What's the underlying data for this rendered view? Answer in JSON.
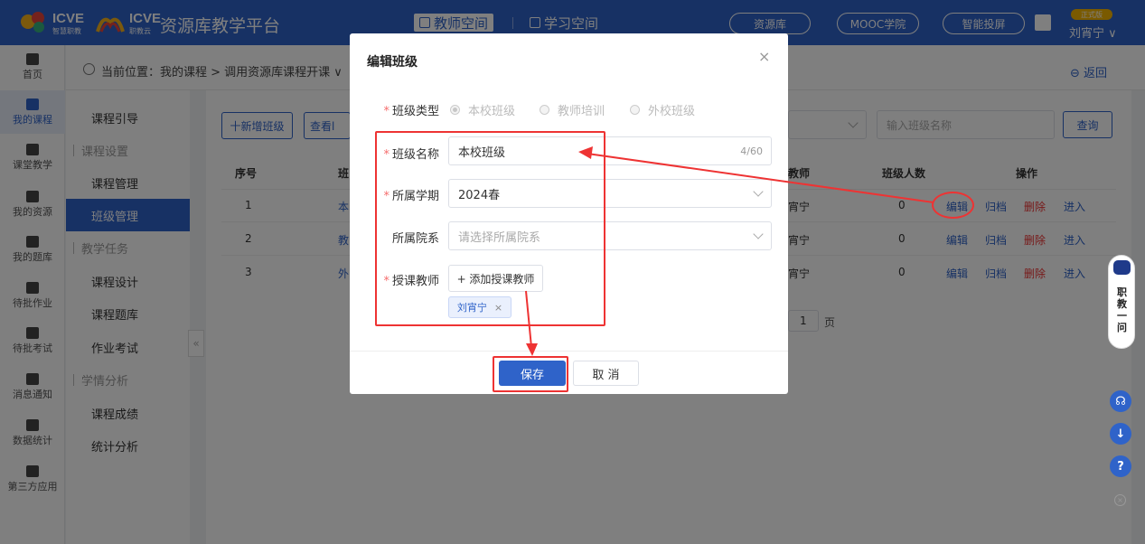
{
  "topbar": {
    "logo_a": "ICVE",
    "logo_a_sub": "智慧职教",
    "logo_b": "ICVE",
    "logo_b_sub": "职教云",
    "brand": "资源库教学平台",
    "spaces": [
      {
        "label": "教师空间",
        "active": true
      },
      {
        "label": "学习空间",
        "active": false
      }
    ],
    "links": [
      "资源库",
      "MOOC学院",
      "智能投屏"
    ],
    "badge": "正式版",
    "user": "刘宵宁 ∨",
    "bg_color": "#2f63c9"
  },
  "leftnav": [
    {
      "label": "首页",
      "icon": "home-icon"
    },
    {
      "label": "我的课程",
      "icon": "book-icon",
      "active": true
    },
    {
      "label": "课堂教学",
      "icon": "play-icon"
    },
    {
      "label": "我的资源",
      "icon": "resource-icon"
    },
    {
      "label": "我的题库",
      "icon": "question-bank-icon"
    },
    {
      "label": "待批作业",
      "icon": "homework-icon"
    },
    {
      "label": "待批考试",
      "icon": "exam-icon"
    },
    {
      "label": "消息通知",
      "icon": "message-icon"
    },
    {
      "label": "数据统计",
      "icon": "chart-icon"
    },
    {
      "label": "第三方应用",
      "icon": "apps-icon"
    }
  ],
  "breadcrumb": {
    "text": "当前位置：我的课程 > 调用资源库课程开课 ∨",
    "back": "返回"
  },
  "submenu": [
    {
      "label": "课程引导",
      "type": "link"
    },
    {
      "label": "课程设置",
      "type": "group"
    },
    {
      "label": "课程管理",
      "type": "link"
    },
    {
      "label": "班级管理",
      "type": "link",
      "active": true
    },
    {
      "label": "教学任务",
      "type": "group"
    },
    {
      "label": "课程设计",
      "type": "link"
    },
    {
      "label": "课程题库",
      "type": "link"
    },
    {
      "label": "作业考试",
      "type": "link"
    },
    {
      "label": "学情分析",
      "type": "group"
    },
    {
      "label": "课程成绩",
      "type": "link"
    },
    {
      "label": "统计分析",
      "type": "link"
    }
  ],
  "toolbar": {
    "add_class": "十新增班级",
    "view": "查看l",
    "search_placeholder": "输入班级名称",
    "query": "查询"
  },
  "table": {
    "headers": [
      "序号",
      "班",
      "教师",
      "班级人数",
      "操作"
    ],
    "rows": [
      {
        "no": "1",
        "name": "本",
        "teacher": "宵宁",
        "count": "0"
      },
      {
        "no": "2",
        "name": "教",
        "teacher": "宵宁",
        "count": "0"
      },
      {
        "no": "3",
        "name": "外",
        "teacher": "宵宁",
        "count": "0"
      }
    ],
    "ops": [
      "编辑",
      "归档",
      "删除",
      "进入"
    ],
    "page": "1",
    "page_suffix": "页"
  },
  "modal": {
    "title": "编辑班级",
    "close": "×",
    "class_type_label": "班级类型",
    "class_type_options": [
      "本校班级",
      "教师培训",
      "外校班级"
    ],
    "class_type_selected": "本校班级",
    "class_name_label": "班级名称",
    "class_name_value": "本校班级",
    "class_name_count": "4/60",
    "semester_label": "所属学期",
    "semester_value": "2024春",
    "dept_label": "所属院系",
    "dept_placeholder": "请选择所属院系",
    "teacher_label": "授课教师",
    "add_teacher": "+ 添加授课教师",
    "teacher_tag": "刘宵宁",
    "teacher_tag_close": "×",
    "save": "保存",
    "cancel": "取 消"
  },
  "assistant": {
    "label": "职教一问"
  },
  "float_buttons": [
    "headset-icon",
    "download-icon",
    "help-icon"
  ],
  "colors": {
    "primary": "#2f63c9",
    "danger": "#e33333",
    "annotation": "#e33333"
  }
}
